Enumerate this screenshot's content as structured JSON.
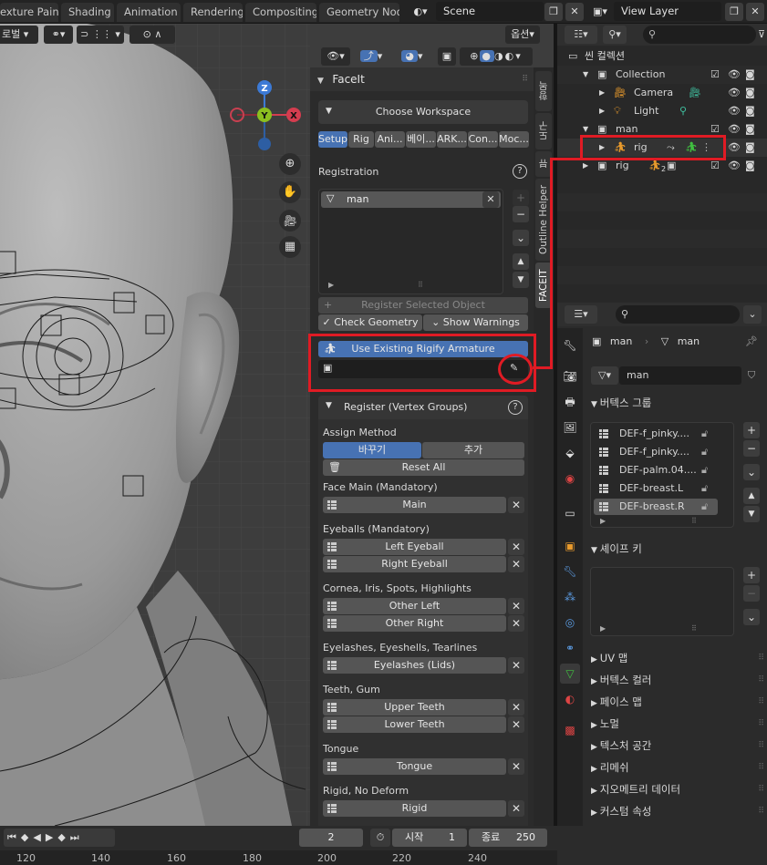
{
  "topbar": {
    "tabs": [
      "exture Paint",
      "Shading",
      "Animation",
      "Rendering",
      "Compositing",
      "Geometry Node"
    ],
    "scene": "Scene",
    "view_layer": "View Layer"
  },
  "viewport_header": {
    "mode_label": "로벌",
    "options_label": "옵션"
  },
  "gizmo": {
    "z": "Z",
    "y": "Y",
    "x": "X"
  },
  "facelt": {
    "panel_title": "FaceIt",
    "choose_workspace": "Choose Workspace",
    "workspace_tabs": [
      "Setup",
      "Rig",
      "Ani...",
      "베이...",
      "ARK...",
      "Con...",
      "Moc..."
    ],
    "registration_label": "Registration",
    "registered_item": "man",
    "register_selected": "Register Selected Object",
    "check_geometry": "Check Geometry",
    "show_warnings": "Show Warnings",
    "use_rigify": "Use Existing Rigify Armature",
    "vertex_groups_title": "Register (Vertex Groups)",
    "assign_method_label": "Assign Method",
    "assign_replace": "바꾸기",
    "assign_add": "추가",
    "reset_all": "Reset All",
    "groups": [
      {
        "title": "Face Main (Mandatory)",
        "buttons": [
          "Main"
        ]
      },
      {
        "title": "Eyeballs (Mandatory)",
        "buttons": [
          "Left Eyeball",
          "Right Eyeball"
        ]
      },
      {
        "title": "Cornea, Iris, Spots, Highlights",
        "buttons": [
          "Other Left",
          "Other Right"
        ]
      },
      {
        "title": "Eyelashes, Eyeshells, Tearlines",
        "buttons": [
          "Eyelashes (Lids)"
        ]
      },
      {
        "title": "Teeth, Gum",
        "buttons": [
          "Upper Teeth",
          "Lower Teeth"
        ]
      },
      {
        "title": "Tongue",
        "buttons": [
          "Tongue"
        ]
      },
      {
        "title": "Rigid, No Deform",
        "buttons": [
          "Rigid"
        ]
      }
    ]
  },
  "side_tabs": [
    "항목",
    "도구",
    "뷰",
    "Outline Helper",
    "FACEIT"
  ],
  "outliner": {
    "search_placeholder": "",
    "root": "씬 컬렉션",
    "rows": [
      {
        "label": "Collection"
      },
      {
        "label": "Camera"
      },
      {
        "label": "Light"
      },
      {
        "label": "man"
      },
      {
        "label": "rig"
      },
      {
        "label": "rig"
      }
    ],
    "rig_sub_count": "2"
  },
  "properties": {
    "breadcrumb_obj": "man",
    "breadcrumb_data": "man",
    "mesh_name": "man",
    "vertex_groups_title": "버텍스 그룹",
    "vertex_groups": [
      "DEF-f_pinky....",
      "DEF-f_pinky....",
      "DEF-palm.04....",
      "DEF-breast.L",
      "DEF-breast.R"
    ],
    "shape_keys_title": "셰이프 키",
    "sections": [
      "UV 맵",
      "버텍스 컬러",
      "페이스 맵",
      "노멀",
      "텍스처 공간",
      "리메쉬",
      "지오메트리 데이터",
      "커스텀 속성"
    ]
  },
  "timeline": {
    "current_frame": "2",
    "start_label": "시작",
    "start_value": "1",
    "end_label": "종료",
    "end_value": "250",
    "ruler": [
      "120",
      "140",
      "160",
      "180",
      "200",
      "220",
      "240"
    ]
  },
  "colors": {
    "accent_blue": "#4772b3",
    "highlight_red": "#e01b24",
    "rig_orange": "#e89a2c",
    "rig_green": "#40c040"
  }
}
